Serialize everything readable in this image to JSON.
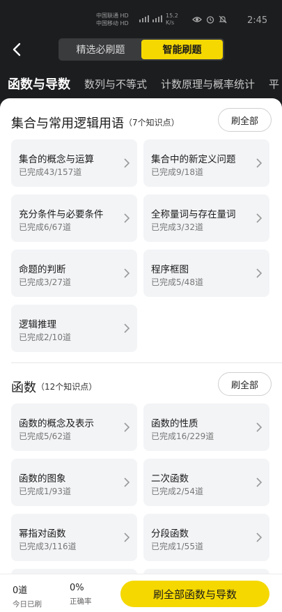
{
  "status_bar": {
    "carrier_1": "中国联通 HD",
    "carrier_2": "中国移动 HD",
    "net_speed_value": "15.2",
    "net_speed_unit": "K/s",
    "time": "2:45"
  },
  "header": {
    "segments": [
      {
        "label": "精选必刷题",
        "active": false
      },
      {
        "label": "智能刷题",
        "active": true
      }
    ]
  },
  "tabs": [
    {
      "label": "函数与导数",
      "active": true
    },
    {
      "label": "数列与不等式"
    },
    {
      "label": "计数原理与概率统计"
    },
    {
      "label": "平"
    }
  ],
  "sections": [
    {
      "title": "集合与常用逻辑用语",
      "count": "（7个知识点）",
      "all_label": "刷全部",
      "cards": [
        {
          "title": "集合的概念与运算",
          "progress": "已完成43/157道"
        },
        {
          "title": "集合中的新定义问题",
          "progress": "已完成9/18道"
        },
        {
          "title": "充分条件与必要条件",
          "progress": "已完成6/67道"
        },
        {
          "title": "全称量词与存在量词",
          "progress": "已完成3/32道"
        },
        {
          "title": "命题的判断",
          "progress": "已完成3/27道"
        },
        {
          "title": "程序框图",
          "progress": "已完成5/48道"
        },
        {
          "title": "逻辑推理",
          "progress": "已完成2/10道"
        }
      ]
    },
    {
      "title": "函数",
      "count": "（12个知识点）",
      "all_label": "刷全部",
      "cards": [
        {
          "title": "函数的概念及表示",
          "progress": "已完成5/62道"
        },
        {
          "title": "函数的性质",
          "progress": "已完成16/229道"
        },
        {
          "title": "函数的图象",
          "progress": "已完成1/93道"
        },
        {
          "title": "二次函数",
          "progress": "已完成2/54道"
        },
        {
          "title": "幂指对函数",
          "progress": "已完成3/116道"
        },
        {
          "title": "分段函数",
          "progress": "已完成1/55道"
        }
      ]
    }
  ],
  "bottom_bar": {
    "today_value": "0道",
    "today_label": "今日已刷",
    "accuracy_value": "0%",
    "accuracy_label": "正确率",
    "cta_label": "刷全部函数与导数"
  },
  "colors": {
    "accent": "#f5d800",
    "dark_bg": "#1c1d1f",
    "card_bg": "#f3f4f6"
  },
  "icons": [
    "back-arrow-icon",
    "chevron-right-icon",
    "signal-icon",
    "eye-icon",
    "alarm-icon",
    "mute-icon"
  ]
}
